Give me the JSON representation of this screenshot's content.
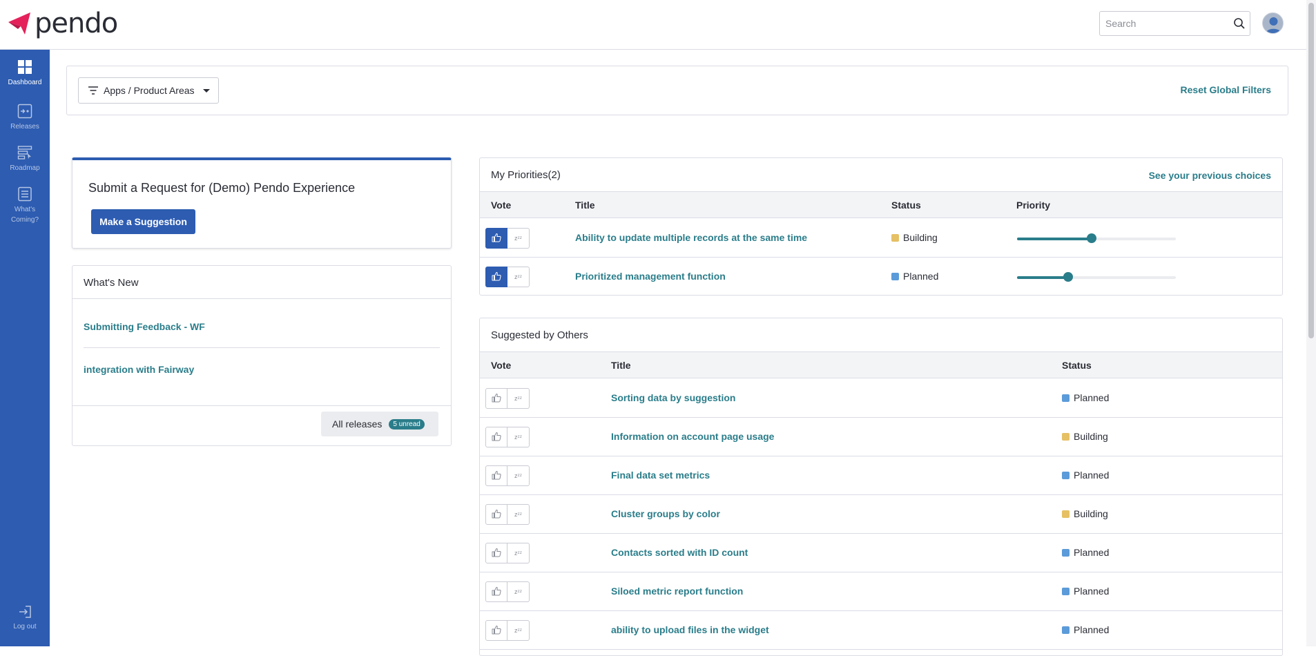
{
  "app": {
    "logo_text": "pendo"
  },
  "header": {
    "search_placeholder": "Search"
  },
  "sidebar": {
    "items": [
      {
        "label": "Dashboard"
      },
      {
        "label": "Releases"
      },
      {
        "label": "Roadmap"
      },
      {
        "label": "What's Coming?"
      }
    ],
    "logout_label": "Log out"
  },
  "filters": {
    "apps_label": "Apps / Product Areas",
    "reset_label": "Reset Global Filters"
  },
  "submit": {
    "title": "Submit a Request for (Demo) Pendo Experience",
    "button_label": "Make a Suggestion"
  },
  "whats_new": {
    "title": "What's New",
    "items": [
      "Submitting Feedback - WF",
      "integration with Fairway"
    ],
    "all_releases_label": "All releases",
    "unread_badge": "5 unread"
  },
  "priorities": {
    "title": "My Priorities(2)",
    "link_label": "See your previous choices",
    "columns": [
      "Vote",
      "Title",
      "Status",
      "Priority"
    ],
    "rows": [
      {
        "title": "Ability to update multiple records at the same time",
        "status": "Building",
        "voted": true,
        "priority": 0.47
      },
      {
        "title": "Prioritized management function",
        "status": "Planned",
        "voted": true,
        "priority": 0.32
      }
    ]
  },
  "others": {
    "title": "Suggested by Others",
    "columns": [
      "Vote",
      "Title",
      "Status"
    ],
    "rows": [
      {
        "title": "Sorting data by suggestion",
        "status": "Planned"
      },
      {
        "title": "Information on account page usage",
        "status": "Building"
      },
      {
        "title": "Final data set metrics",
        "status": "Planned"
      },
      {
        "title": "Cluster groups by color",
        "status": "Building"
      },
      {
        "title": "Contacts sorted with ID count",
        "status": "Planned"
      },
      {
        "title": "Siloed metric report function",
        "status": "Planned"
      },
      {
        "title": "ability to upload files in the widget",
        "status": "Planned"
      }
    ]
  },
  "vote": {
    "snooze_glyph": "zᶻᶻ"
  },
  "colors": {
    "brand_blue": "#2d5cb1",
    "link_teal": "#2a7d8a",
    "status_building": "#e6c064",
    "status_planned": "#5b9bd9",
    "logo_pink": "#e4215a"
  }
}
